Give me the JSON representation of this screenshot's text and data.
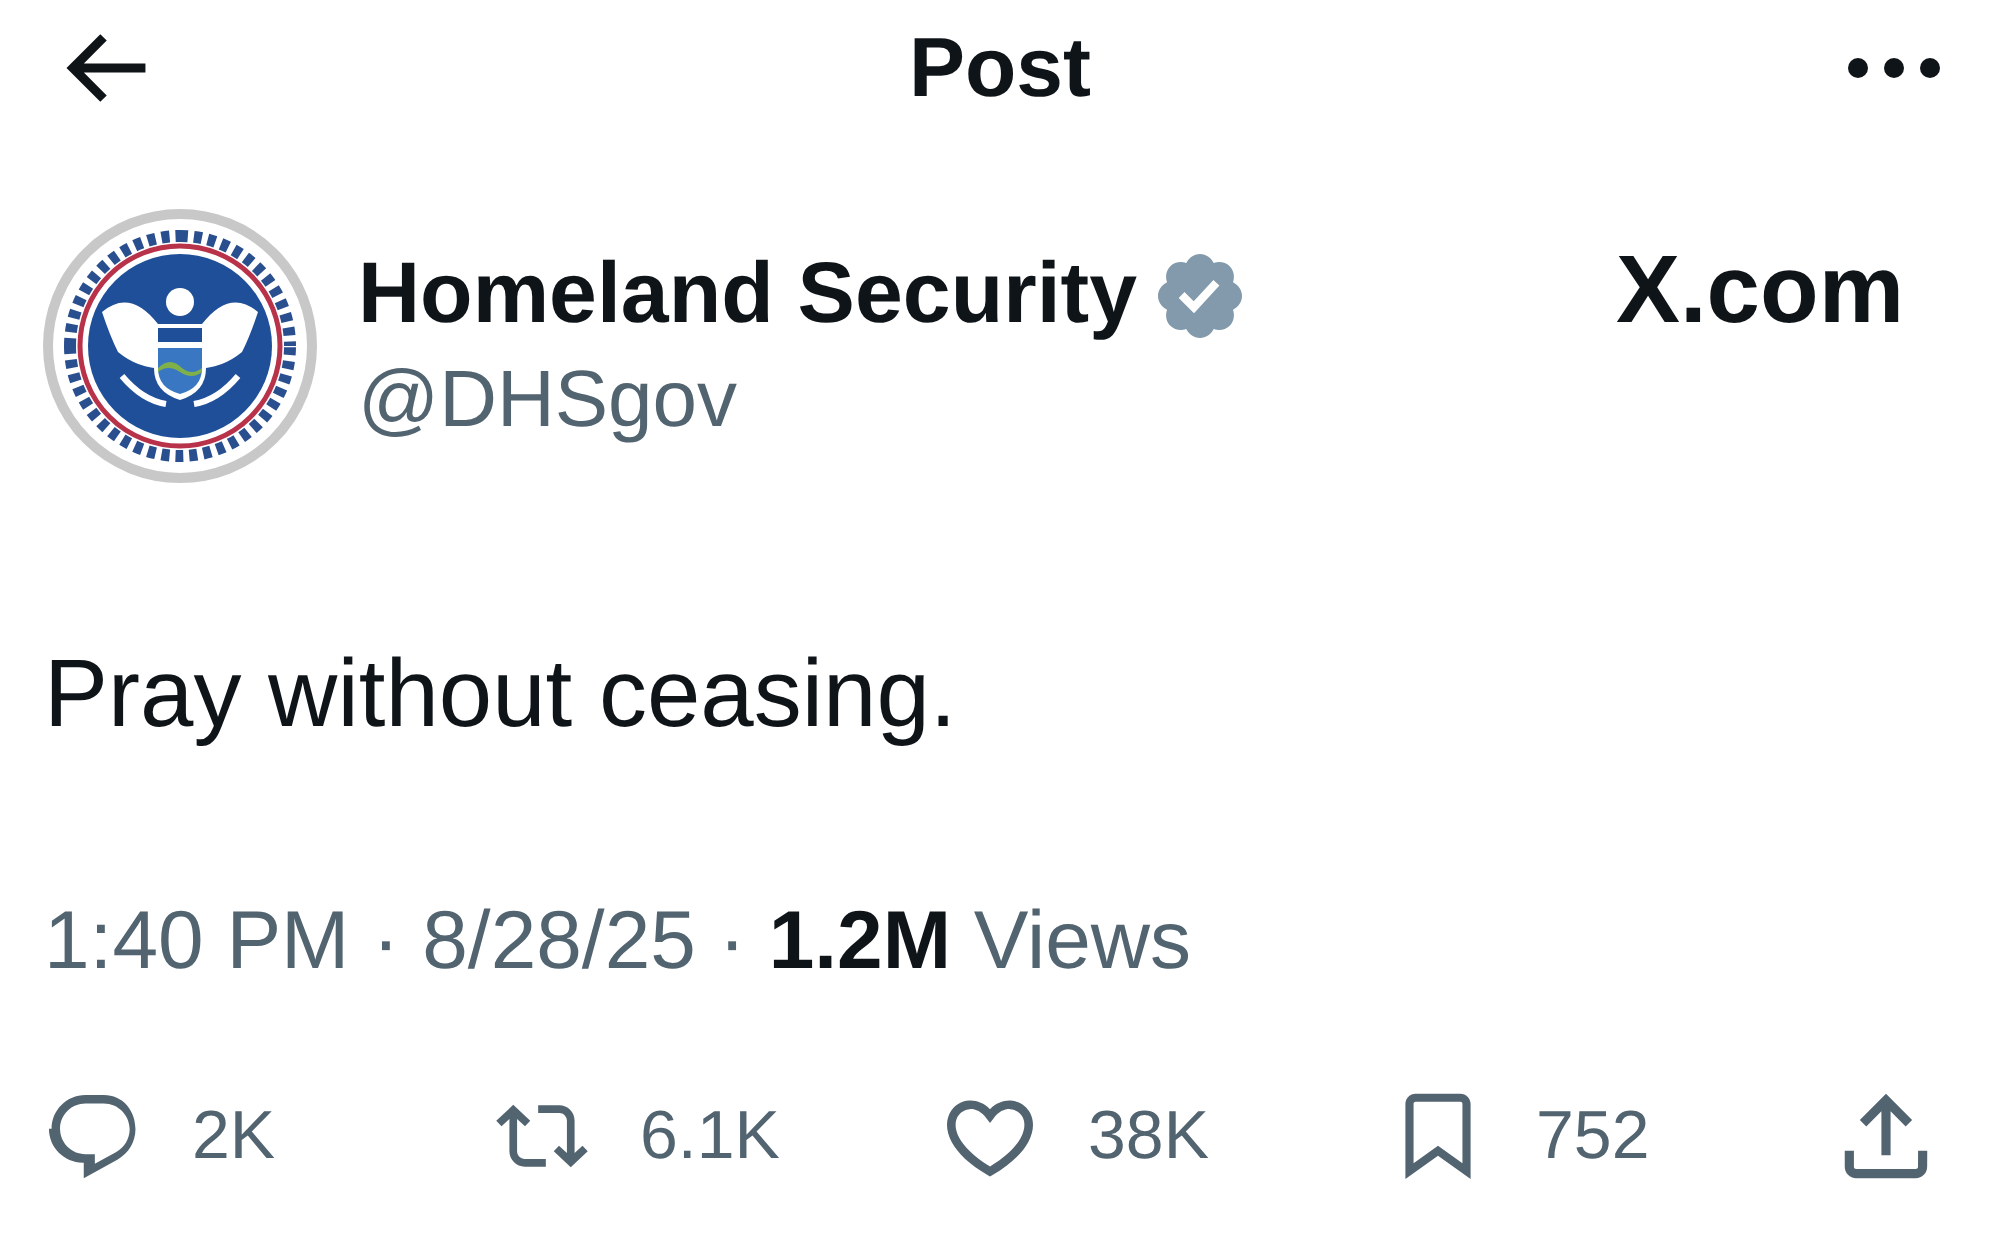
{
  "header": {
    "title": "Post"
  },
  "author": {
    "name": "Homeland Security",
    "verified": true,
    "handle": "@DHSgov"
  },
  "source_label": "X.com",
  "post": {
    "text": "Pray without ceasing.",
    "meta": "1:40 PM · 8/28/25 · **1.2M** Views"
  },
  "actions": [
    {
      "kind": "reply",
      "count": "2K"
    },
    {
      "kind": "repost",
      "count": "6.1K"
    },
    {
      "kind": "like",
      "count": "38K"
    },
    {
      "kind": "bookmark",
      "count": "752"
    },
    {
      "kind": "share"
    }
  ]
}
